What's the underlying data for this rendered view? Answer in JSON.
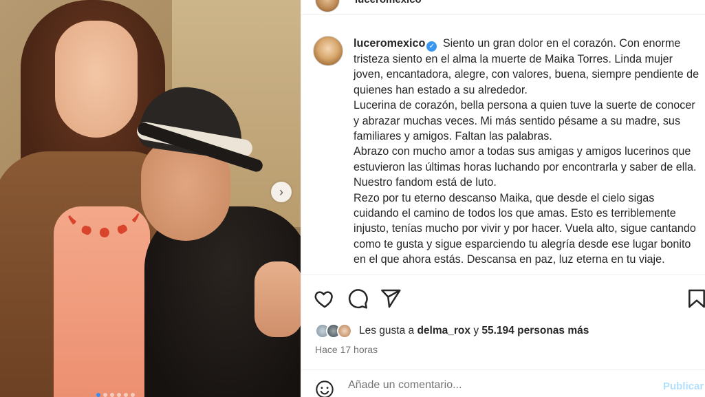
{
  "post": {
    "username": "luceromexico",
    "verified_icon": "verified-badge-icon",
    "caption_paragraphs": [
      "Siento un gran dolor en el corazón. Con enorme tristeza siento en el alma la muerte de Maika Torres. Linda mujer joven, encantadora, alegre, con valores, buena, siempre pendiente de quienes han estado a su alrededor.",
      "Lucerina de corazón, bella persona a quien tuve la suerte de conocer y abrazar muchas veces. Mi más sentido pésame a su madre, sus familiares y amigos. Faltan las palabras.",
      "Abrazo con mucho amor a todas sus amigas y amigos lucerinos que estuvieron las últimas horas luchando por encontrarla y saber de ella. Nuestro fandom está de luto.",
      "Rezo por tu eterno descanso Maika, que desde el cielo sigas cuidando el camino de todos los que amas. Esto es terriblemente injusto, tenías mucho por vivir y por hacer. Vuela alto, sigue cantando como te gusta y sigue esparciendo tu alegría desde ese lugar bonito en el que ahora estás. Descansa en paz, luz eterna en tu viaje."
    ],
    "likes_prefix": "Les gusta a",
    "likes_user": "delma_rox",
    "likes_joiner": "y",
    "likes_count": "55.194 personas más",
    "timestamp": "Hace 17 horas"
  },
  "carousel": {
    "total_slides": 6,
    "active_slide": 1,
    "next_icon": "chevron-right-icon"
  },
  "actions": {
    "icons": [
      "heart-icon",
      "comment-icon",
      "share-icon",
      "bookmark-icon"
    ]
  },
  "comment_box": {
    "placeholder": "Añade un comentario...",
    "post_label": "Publicar",
    "emoji_icon": "emoji-icon"
  },
  "colors": {
    "accent": "#3797f0",
    "post_disabled": "#b2dffc",
    "muted": "#737373"
  }
}
